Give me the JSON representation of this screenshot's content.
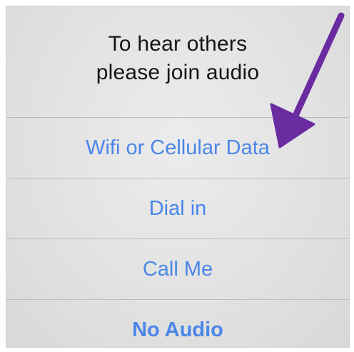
{
  "dialog": {
    "title_line1": "To hear others",
    "title_line2": "please join audio",
    "options": [
      {
        "label": "Wifi or Cellular Data"
      },
      {
        "label": "Dial in"
      },
      {
        "label": "Call Me"
      },
      {
        "label": "No Audio"
      }
    ]
  },
  "colors": {
    "option_text": "#4a86e8",
    "arrow": "#6a2ba0",
    "title_text": "#151515"
  },
  "annotation": {
    "icon": "pointer-arrow-icon"
  }
}
